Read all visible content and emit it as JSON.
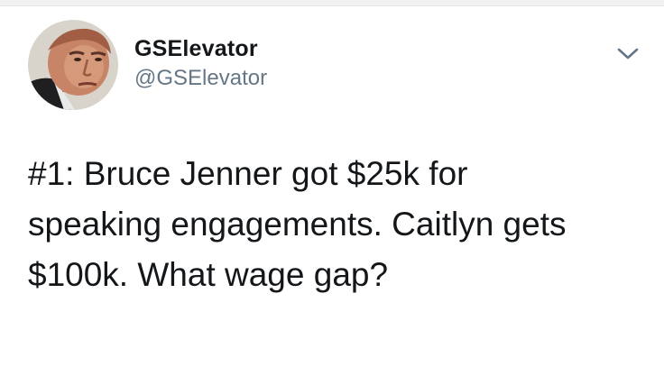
{
  "tweet": {
    "author": {
      "display_name": "GSElevator",
      "handle": "@GSElevator",
      "avatar_icon": "profile-photo"
    },
    "menu_icon": "chevron-down-icon",
    "text": "#1: Bruce Jenner got $25k for\nspeaking engagements. Caitlyn gets\n$100k. What wage gap?"
  },
  "colors": {
    "text_primary": "#14171a",
    "text_secondary": "#657786",
    "background": "#ffffff"
  }
}
